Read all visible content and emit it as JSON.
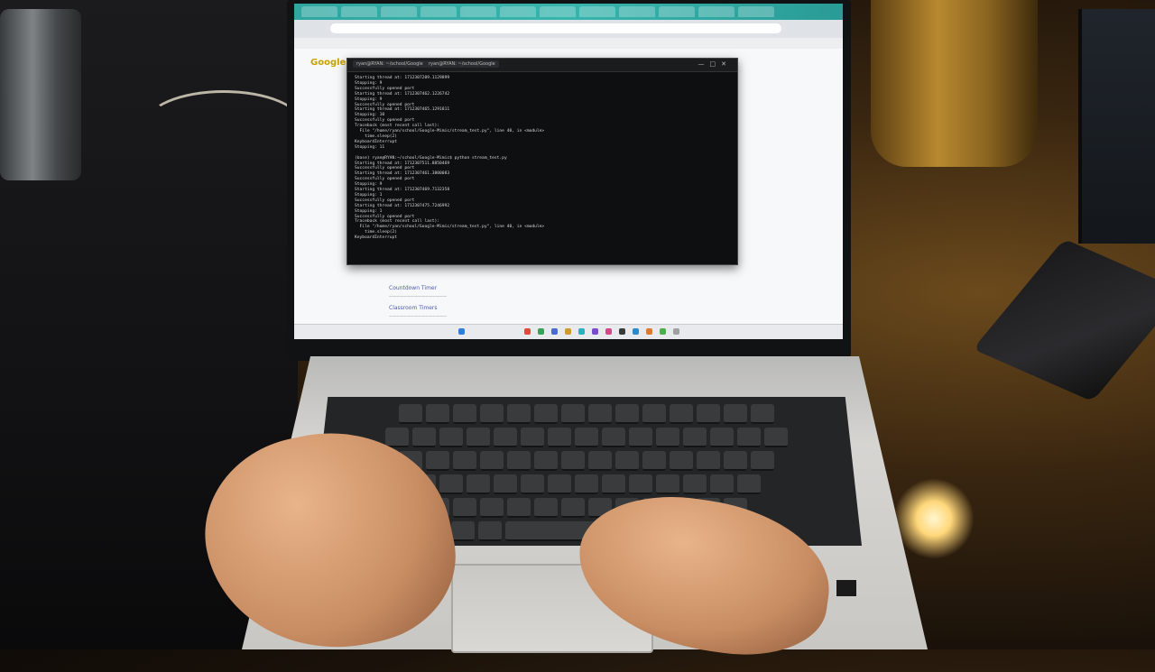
{
  "scene": {
    "description_objects": [
      "laptop",
      "terminal-window",
      "browser",
      "keyboard",
      "touchpad",
      "hands",
      "gold-vase",
      "smartphone"
    ]
  },
  "terminal": {
    "lines": [
      "Starting thread at: 1712307209.1129899",
      "Stopping: 9",
      "Successfully opened port",
      "Starting thread at: 1712307462.1226742",
      "Stopping: 9",
      "Successfully opened port",
      "Starting thread at: 1712307465.1291811",
      "Stopping: 10",
      "Successfully opened port",
      "Traceback (most recent call last):",
      "  File \"/home/ryan/school/Google-Mimic/stream_test.py\", line 40, in <module>",
      "    time.sleep(2)",
      "KeyboardInterrupt",
      "Stopping: 11",
      "",
      "(base) ryan@RYAN:~/school/Google-Mimic$ python stream_test.py",
      "Starting thread at: 1712307511.8850469",
      "Successfully opened port",
      "Starting thread at: 1712307461.3800083",
      "Successfully opened port",
      "Stopping: 9",
      "Starting thread at: 1712307469.7132358",
      "Stopping: 1",
      "Successfully opened port",
      "Starting thread at: 1712307475.7246992",
      "Stopping: 1",
      "Successfully opened port",
      "Traceback (most recent call last):",
      "  File \"/home/ryan/school/Google-Mimic/stream_test.py\", line 40, in <module>",
      "    time.sleep(2)",
      "KeyboardInterrupt"
    ]
  },
  "browser": {
    "logo": "Google",
    "results": [
      "Countdown Timer",
      "Classroom Timers"
    ]
  }
}
